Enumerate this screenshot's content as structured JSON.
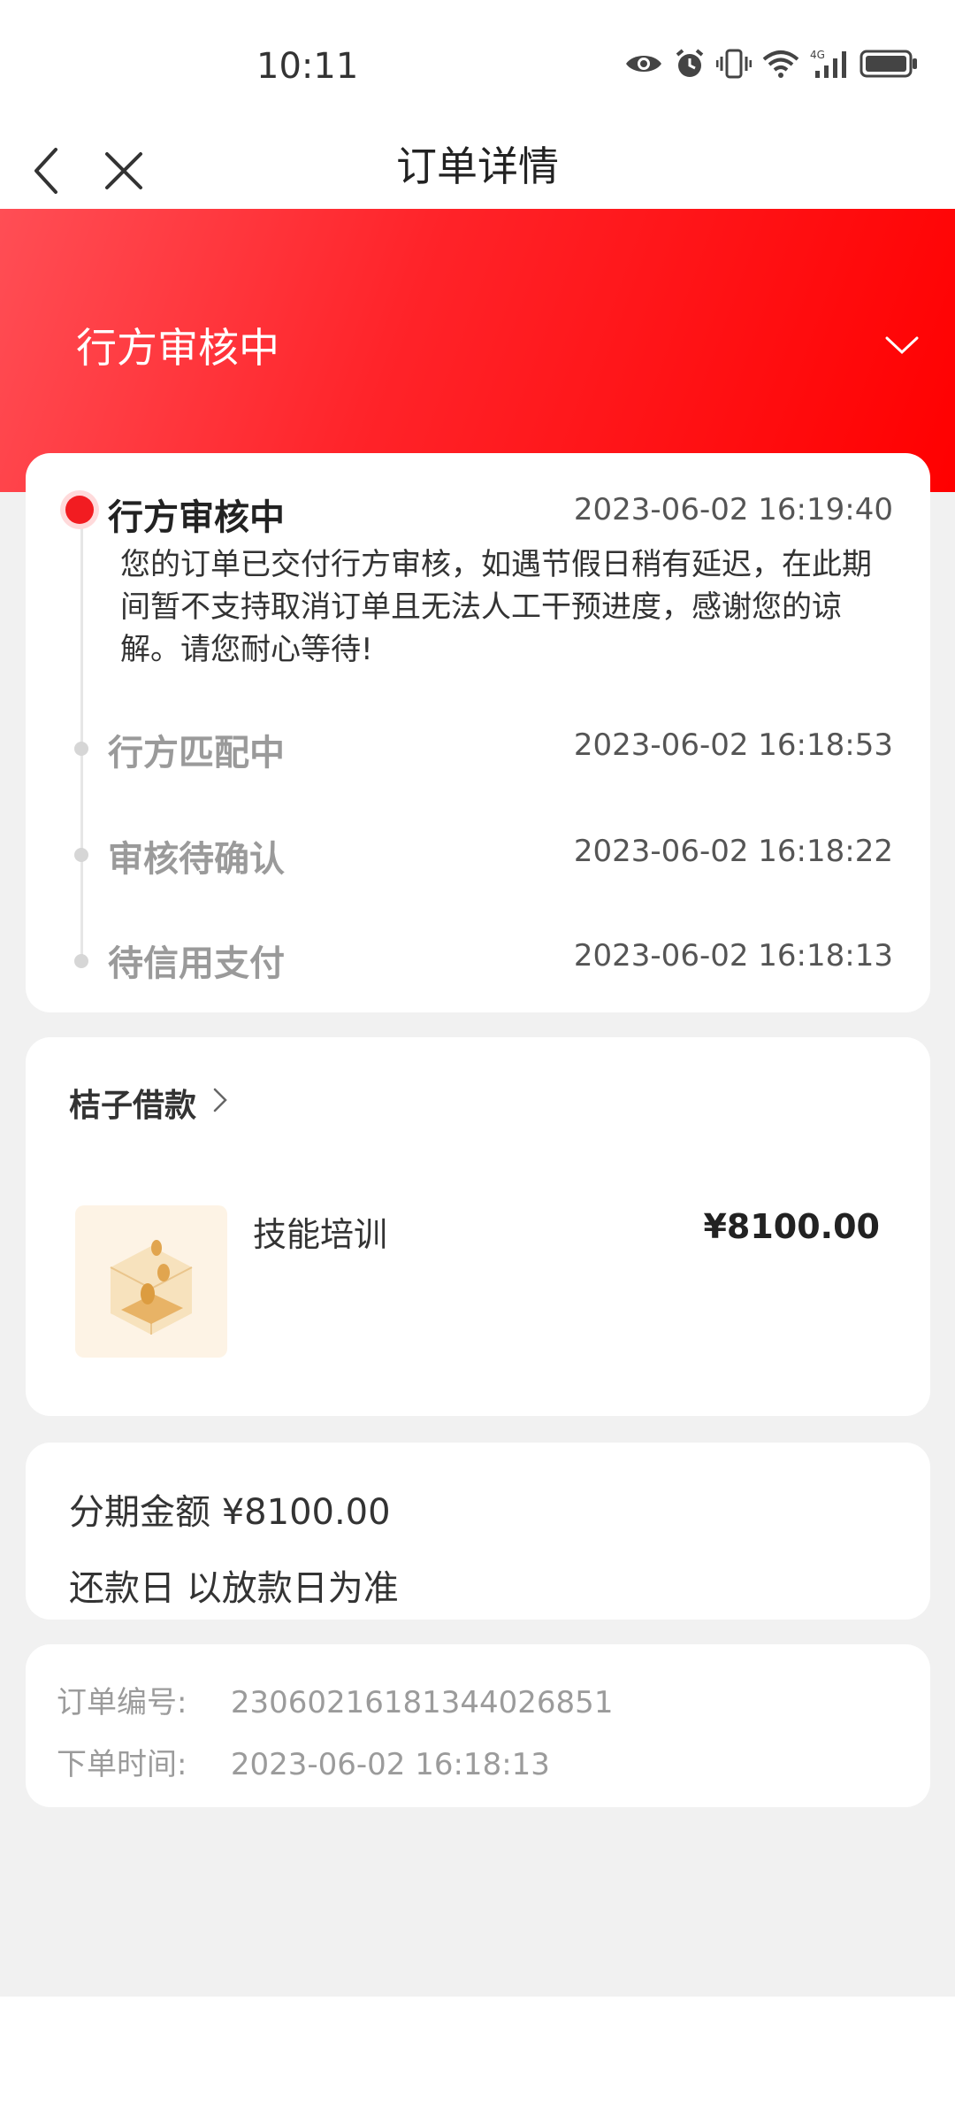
{
  "status_bar": {
    "time": "10:11",
    "icons": [
      "eye-icon",
      "alarm-icon",
      "vibrate-icon",
      "wifi-icon",
      "signal-4g-icon",
      "battery-icon"
    ],
    "network_label": "4G"
  },
  "nav": {
    "title": "订单详情",
    "back_icon": "chevron-left-icon",
    "close_icon": "close-icon"
  },
  "header": {
    "status": "行方审核中",
    "expand_icon": "chevron-down-icon"
  },
  "progress": {
    "steps": [
      {
        "title": "行方审核中",
        "time": "2023-06-02 16:19:40",
        "active": true,
        "description": "您的订单已交付行方审核，如遇节假日稍有延迟，在此期间暂不支持取消订单且无法人工干预进度，感谢您的谅解。请您耐心等待!"
      },
      {
        "title": "行方匹配中",
        "time": "2023-06-02 16:18:53",
        "active": false
      },
      {
        "title": "审核待确认",
        "time": "2023-06-02 16:18:22",
        "active": false
      },
      {
        "title": "待信用支付",
        "time": "2023-06-02 16:18:13",
        "active": false
      }
    ]
  },
  "lender": {
    "name": "桔子借款",
    "arrow_icon": "chevron-right-icon",
    "product": {
      "name": "技能培训",
      "price": "¥8100.00",
      "image_icon": "coin-box-icon"
    }
  },
  "installment": {
    "amount_label": "分期金额",
    "amount": "¥8100.00",
    "repayment_label": "还款日",
    "repayment_value": "以放款日为准"
  },
  "order": {
    "number_label": "订单编号:",
    "number": "2306021618134402685​1",
    "time_label": "下单时间:",
    "time": "2023-06-02 16:18:13"
  },
  "colors": {
    "primary_red": "#ff0000",
    "active_dot": "#f21c21",
    "page_gray": "#f1f1f1"
  }
}
